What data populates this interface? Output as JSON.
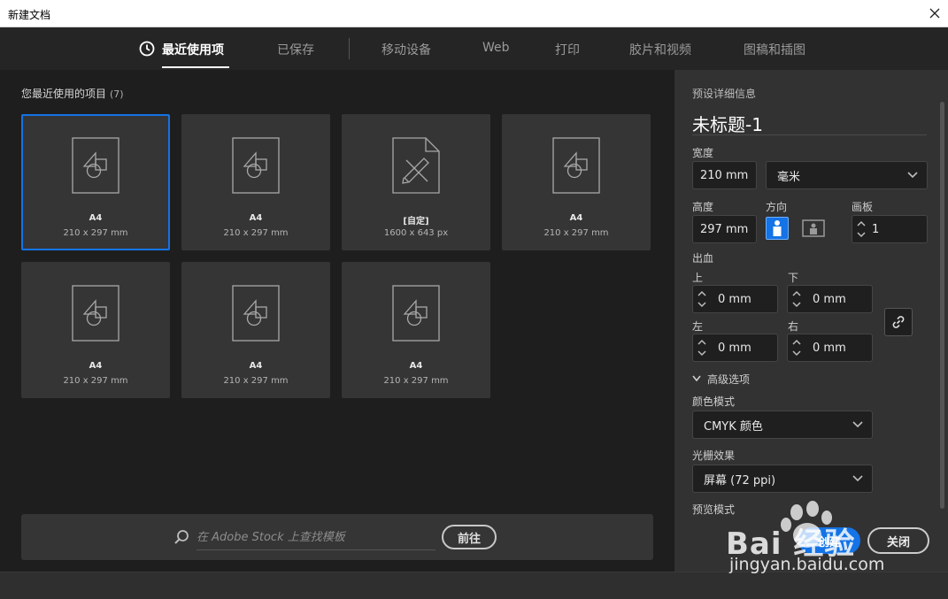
{
  "window": {
    "title": "新建文档"
  },
  "tabs": [
    {
      "label": "最近使用项",
      "active": true
    },
    {
      "label": "已保存"
    },
    {
      "label": "移动设备"
    },
    {
      "label": "Web"
    },
    {
      "label": "打印"
    },
    {
      "label": "胶片和视频"
    },
    {
      "label": "图稿和插图"
    }
  ],
  "recent": {
    "header": "您最近使用的项目",
    "count": "(7)",
    "items": [
      {
        "name": "A4",
        "size": "210 x 297 mm",
        "selected": true,
        "icon": "document-shapes-icon"
      },
      {
        "name": "A4",
        "size": "210 x 297 mm",
        "icon": "document-shapes-icon"
      },
      {
        "name": "[自定]",
        "size": "1600 x 643 px",
        "icon": "document-tools-icon"
      },
      {
        "name": "A4",
        "size": "210 x 297 mm",
        "icon": "document-shapes-icon"
      },
      {
        "name": "A4",
        "size": "210 x 297 mm",
        "icon": "document-shapes-icon"
      },
      {
        "name": "A4",
        "size": "210 x 297 mm",
        "icon": "document-shapes-icon"
      },
      {
        "name": "A4",
        "size": "210 x 297 mm",
        "icon": "document-shapes-icon"
      }
    ]
  },
  "search": {
    "placeholder": "在 Adobe Stock 上查找模板",
    "go_label": "前往"
  },
  "preset": {
    "section_title": "预设详细信息",
    "doc_name": "未标题-1",
    "width_label": "宽度",
    "width_value": "210 mm",
    "unit_value": "毫米",
    "height_label": "高度",
    "height_value": "297 mm",
    "orientation_label": "方向",
    "artboards_label": "画板",
    "artboards_value": "1",
    "bleed_label": "出血",
    "bleed_top_label": "上",
    "bleed_top_value": "0 mm",
    "bleed_bottom_label": "下",
    "bleed_bottom_value": "0 mm",
    "bleed_left_label": "左",
    "bleed_left_value": "0 mm",
    "bleed_right_label": "右",
    "bleed_right_value": "0 mm",
    "advanced_label": "高级选项",
    "color_mode_label": "颜色模式",
    "color_mode_value": "CMYK 颜色",
    "raster_label": "光栅效果",
    "raster_value": "屏幕 (72 ppi)",
    "preview_label": "预览模式"
  },
  "actions": {
    "create_label": "创建",
    "close_label": "关闭"
  },
  "watermark": {
    "text": "Bai 经验",
    "url": "jingyan.baidu.com"
  },
  "colors": {
    "accent": "#1473e6",
    "panel": "#323232",
    "background": "#1e1e1e"
  }
}
